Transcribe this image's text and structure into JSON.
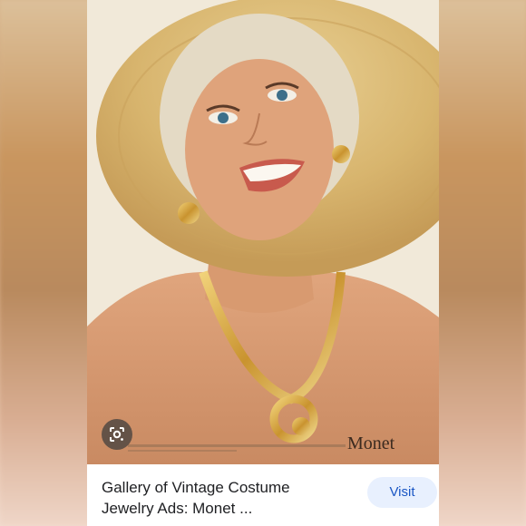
{
  "result": {
    "title": "Gallery of Vintage Costume Jewelry Ads: Monet ...",
    "visit_label": "Visit"
  },
  "ad": {
    "brand_logo_text": "Monet"
  },
  "icons": {
    "lens": "google-lens-icon"
  },
  "colors": {
    "visit_button_bg": "#e8f0fe",
    "visit_button_text": "#1a56c4",
    "card_bg": "#ffffff"
  }
}
